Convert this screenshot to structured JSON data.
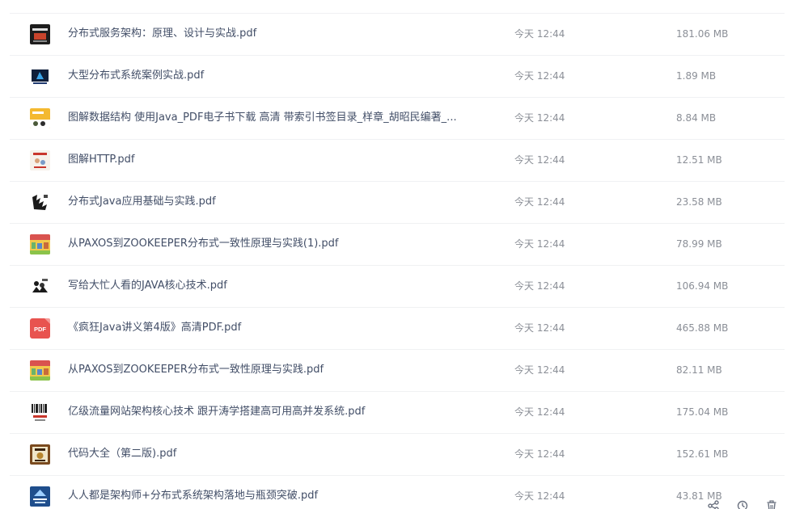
{
  "files": [
    {
      "name": "分布式服务架构：原理、设计与实战.pdf",
      "time": "今天 12:44",
      "size": "181.06 MB",
      "icon": "book-cover-icon"
    },
    {
      "name": "大型分布式系统案例实战.pdf",
      "time": "今天 12:44",
      "size": "1.89 MB",
      "icon": "book-cover-icon"
    },
    {
      "name": "图解数据结构 使用Java_PDF电子书下载 高清 带索引书签目录_样章_胡昭民编著_...",
      "time": "今天 12:44",
      "size": "8.84 MB",
      "icon": "book-cover-icon"
    },
    {
      "name": "图解HTTP.pdf",
      "time": "今天 12:44",
      "size": "12.51 MB",
      "icon": "book-cover-icon"
    },
    {
      "name": "分布式Java应用基础与实践.pdf",
      "time": "今天 12:44",
      "size": "23.58 MB",
      "icon": "book-cover-icon"
    },
    {
      "name": "从PAXOS到ZOOKEEPER分布式一致性原理与实践(1).pdf",
      "time": "今天 12:44",
      "size": "78.99 MB",
      "icon": "book-cover-icon"
    },
    {
      "name": "写给大忙人看的JAVA核心技术.pdf",
      "time": "今天 12:44",
      "size": "106.94 MB",
      "icon": "book-cover-icon"
    },
    {
      "name": "《疯狂Java讲义第4版》高清PDF.pdf",
      "time": "今天 12:44",
      "size": "465.88 MB",
      "icon": "pdf-file-icon",
      "icon_label": "PDF"
    },
    {
      "name": "从PAXOS到ZOOKEEPER分布式一致性原理与实践.pdf",
      "time": "今天 12:44",
      "size": "82.11 MB",
      "icon": "book-cover-icon"
    },
    {
      "name": "亿级流量网站架构核心技术 跟开涛学搭建高可用高并发系统.pdf",
      "time": "今天 12:44",
      "size": "175.04 MB",
      "icon": "book-cover-icon"
    },
    {
      "name": "代码大全（第二版).pdf",
      "time": "今天 12:44",
      "size": "152.61 MB",
      "icon": "book-cover-icon"
    },
    {
      "name": "人人都是架构师+分布式系统架构落地与瓶颈突破.pdf",
      "time": "今天 12:44",
      "size": "43.81 MB",
      "icon": "book-cover-icon"
    }
  ],
  "toolbar": {
    "icons": [
      "share-icon",
      "history-icon",
      "delete-icon"
    ]
  },
  "colors": {
    "filename": "#424e67",
    "meta": "#8b8f97",
    "divider": "#f0f1f3",
    "pdf_badge": "#e8534f"
  }
}
